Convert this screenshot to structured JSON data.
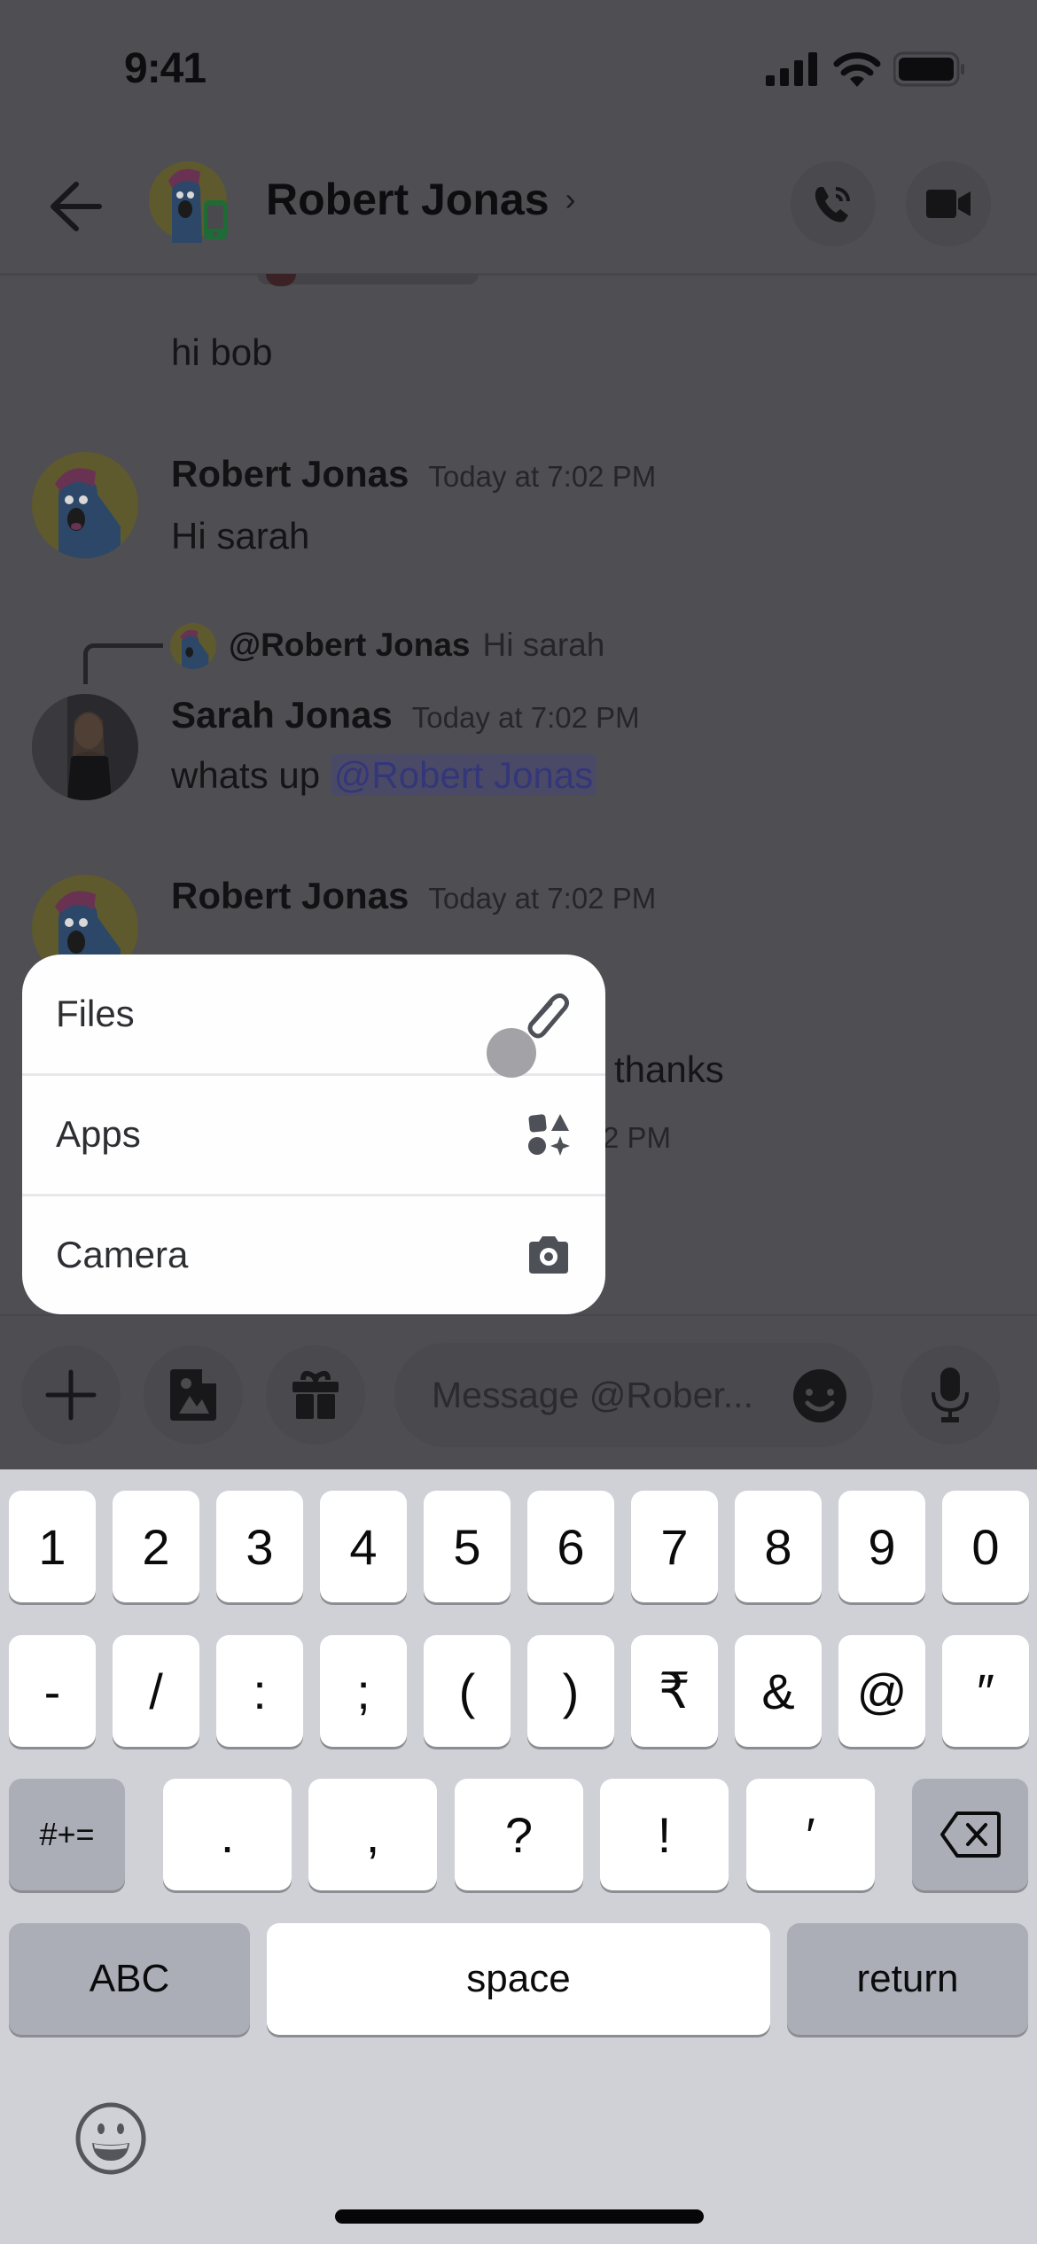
{
  "status_bar": {
    "time": "9:41",
    "icons": [
      "cellular-signal-icon",
      "wifi-icon",
      "battery-icon"
    ]
  },
  "header": {
    "title": "Robert Jonas",
    "chevron": "›",
    "back_icon": "arrow-left-icon",
    "call_icon": "phone-call-icon",
    "video_icon": "video-camera-icon",
    "presence": "mobile"
  },
  "messages": [
    {
      "type": "continuation",
      "text": "hi bob"
    },
    {
      "type": "message",
      "author": "Robert Jonas",
      "timestamp": "Today at 7:02 PM",
      "text": "Hi sarah"
    },
    {
      "type": "reply",
      "reply_to": {
        "author": "@Robert Jonas",
        "text": "Hi sarah"
      },
      "author": "Sarah Jonas",
      "timestamp": "Today at 7:02 PM",
      "text": "whats up ",
      "mention": "@Robert Jonas"
    },
    {
      "type": "message",
      "author": "Robert Jonas",
      "timestamp": "Today at 7:02 PM",
      "text": "I'm good thanks",
      "visible_fragment": "l thanks"
    },
    {
      "type": "partial",
      "visible_fragment": "2 PM"
    }
  ],
  "attach_menu": {
    "items": [
      {
        "label": "Files",
        "icon": "paperclip-icon"
      },
      {
        "label": "Apps",
        "icon": "apps-icon"
      },
      {
        "label": "Camera",
        "icon": "camera-icon"
      }
    ]
  },
  "composer": {
    "placeholder": "Message @Rober...",
    "buttons": [
      "plus-icon",
      "image-icon",
      "gift-icon",
      "microphone-icon"
    ],
    "emoji_icon": "emoji-icon"
  },
  "keyboard": {
    "row1": [
      "1",
      "2",
      "3",
      "4",
      "5",
      "6",
      "7",
      "8",
      "9",
      "0"
    ],
    "row2": [
      "-",
      "/",
      ":",
      ";",
      "(",
      ")",
      "₹",
      "&",
      "@",
      "″"
    ],
    "row3_left": "#+=",
    "row3": [
      ".",
      ",",
      "?",
      "!",
      "′"
    ],
    "row3_right_icon": "backspace-icon",
    "row4": {
      "left": "ABC",
      "space": "space",
      "right": "return"
    },
    "emoji_icon": "emoji-keyboard-icon"
  },
  "colors": {
    "overlay_bg": "#4f4e53",
    "menu_bg": "#fefefe",
    "keyboard_bg": "#d0d1d6",
    "key_bg": "#ffffff",
    "key_dark_bg": "#abaeb7",
    "mention_text": "#34367a",
    "presence_green": "#1f7a3c"
  }
}
